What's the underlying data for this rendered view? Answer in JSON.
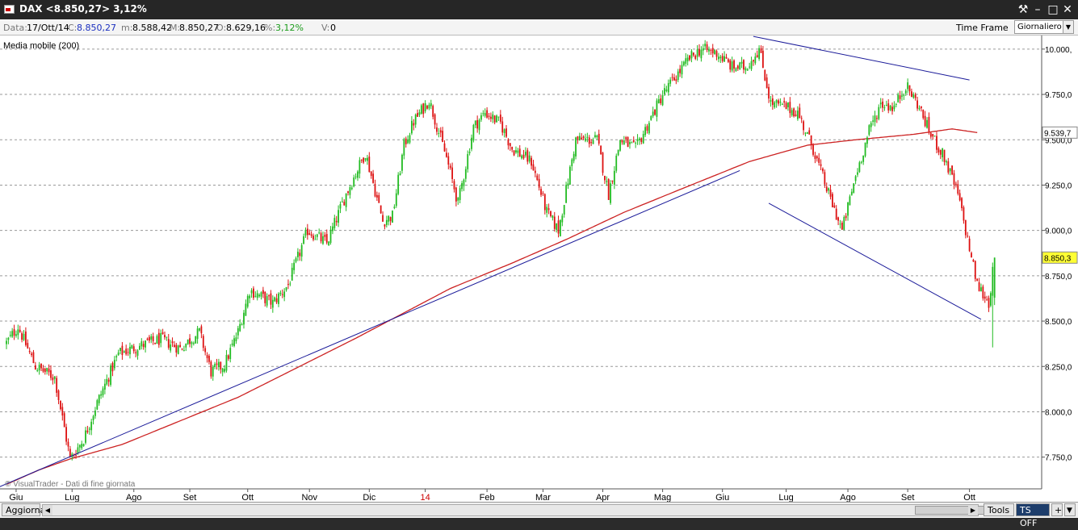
{
  "window": {
    "title": "DAX <8.850,27> 3,12%",
    "buttons": [
      "⚒",
      "–",
      "□",
      "✕"
    ]
  },
  "infobar": {
    "data_label": "Data:",
    "data_value": "17/Ott/14",
    "c_label": "C:",
    "c_value": "8.850,27",
    "m_label": "m:",
    "m_value": "8.588,42",
    "M_label": "M:",
    "M_value": "8.850,27",
    "o_label": "O:",
    "o_value": "8.629,16",
    "pct_label": "%:",
    "pct_value": "3,12%",
    "v_label": "V:",
    "v_value": "0",
    "timeframe_label": "Time Frame",
    "timeframe_value": "Giornaliero"
  },
  "indicator_label": "Media mobile (200)",
  "watermark": "© VisualTrader - Dati di fine giornata",
  "bottombar": {
    "update_button": "Aggiorna",
    "tools_button": "Tools",
    "ts_button": "TS OFF",
    "plus": "+"
  },
  "colors": {
    "up": "#22bb22",
    "down": "#dd1111",
    "ma": "#cc2222",
    "trendline": "#1a1a99",
    "grid": "#9a9a9a",
    "last_price_bg": "#ffff33",
    "ma_label_bg": "#ffffff"
  },
  "chart_data": {
    "type": "candlestick",
    "title": "DAX",
    "y_axis": {
      "ticks": [
        7750,
        8000,
        8250,
        8500,
        8750,
        9000,
        9250,
        9500,
        9750,
        10000
      ],
      "tick_labels": [
        "7.750,0",
        "8.000,0",
        "8.250,0",
        "8.500,0",
        "8.750,0",
        "9.000,0",
        "9.250,0",
        "9.500,0",
        "9.750,0",
        "10.000,"
      ],
      "ylim": [
        7575,
        10075
      ],
      "grid": true,
      "position": "right"
    },
    "x_axis": {
      "labels": [
        "Giu",
        "Lug",
        "Ago",
        "Set",
        "Ott",
        "Nov",
        "Dic",
        "14",
        "Feb",
        "Mar",
        "Apr",
        "Mag",
        "Giu",
        "Lug",
        "Ago",
        "Set",
        "Ott"
      ],
      "label_bar_index": [
        5,
        34,
        66,
        95,
        125,
        157,
        188,
        217,
        249,
        278,
        309,
        340,
        371,
        404,
        436,
        467,
        499
      ],
      "special_label": "14",
      "special_color": "#cc0000"
    },
    "price_anchors": {
      "bar": [
        0,
        6,
        15,
        25,
        33,
        40,
        47,
        58,
        68,
        80,
        90,
        100,
        106,
        113,
        120,
        126,
        138,
        146,
        156,
        166,
        176,
        186,
        195,
        200,
        206,
        211,
        219,
        228,
        234,
        242,
        248,
        256,
        262,
        272,
        280,
        286,
        295,
        306,
        312,
        318,
        326,
        340,
        354,
        360,
        368,
        376,
        383,
        390,
        396,
        404,
        410,
        418,
        426,
        433,
        440,
        447,
        453,
        460,
        466,
        472,
        478,
        486,
        493,
        498,
        503,
        509,
        512,
        517
      ],
      "close": [
        8380,
        8470,
        8250,
        8190,
        7740,
        7850,
        8050,
        8320,
        8360,
        8400,
        8350,
        8440,
        8220,
        8260,
        8440,
        8670,
        8600,
        8700,
        9000,
        8930,
        9200,
        9430,
        9050,
        9080,
        9470,
        9600,
        9720,
        9400,
        9150,
        9570,
        9650,
        9590,
        9450,
        9380,
        9100,
        9000,
        9500,
        9500,
        9200,
        9500,
        9450,
        9750,
        9950,
        10000,
        9980,
        9900,
        9900,
        10000,
        9700,
        9680,
        9650,
        9450,
        9200,
        9000,
        9300,
        9550,
        9700,
        9680,
        9800,
        9700,
        9550,
        9400,
        9200,
        8950,
        8700,
        8600,
        8850,
        8850
      ]
    },
    "moving_average_200": {
      "name": "Media mobile (200)",
      "bar": [
        0,
        17,
        33,
        60,
        120,
        180,
        230,
        262,
        290,
        320,
        350,
        385,
        415,
        440,
        470,
        490,
        503
      ],
      "value": [
        7600,
        7680,
        7740,
        7820,
        8080,
        8400,
        8680,
        8820,
        8950,
        9100,
        9230,
        9380,
        9470,
        9500,
        9530,
        9560,
        9539.7
      ],
      "last_label": "9.539,7"
    },
    "trendlines": [
      {
        "from_bar": -5,
        "from_price": 7580,
        "to_bar": 380,
        "to_price": 9330
      },
      {
        "from_bar": 387,
        "from_price": 10070,
        "to_bar": 499,
        "to_price": 9830
      },
      {
        "from_bar": 395,
        "from_price": 9150,
        "to_bar": 505,
        "to_price": 8510
      }
    ],
    "last_price": {
      "value": 8850.27,
      "label": "8.850,3"
    },
    "n_bars": 513
  }
}
